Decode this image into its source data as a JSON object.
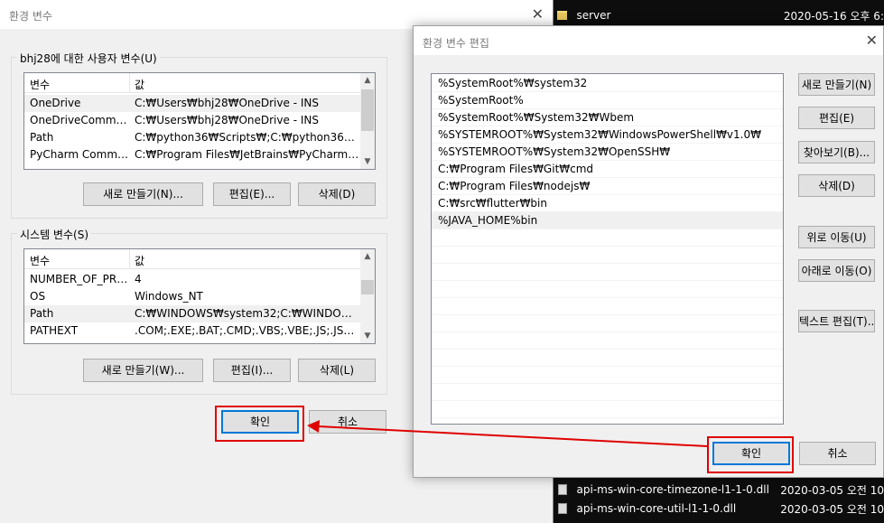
{
  "background": {
    "rows": [
      {
        "name": "server",
        "date": "2020-05-16 오후 6:",
        "type": "folder"
      },
      {
        "name": "api-ms-win-core-timezone-l1-1-0.dll",
        "date": "2020-03-05 오전 10",
        "type": "dll"
      },
      {
        "name": "api-ms-win-core-util-l1-1-0.dll",
        "date": "2020-03-05 오전 10",
        "type": "dll"
      }
    ]
  },
  "main_dialog": {
    "title": "환경 변수",
    "close": "✕",
    "user_group": {
      "legend": "bhj28에 대한 사용자 변수(U)",
      "columns": [
        "변수",
        "값"
      ],
      "rows": [
        {
          "name": "OneDrive",
          "value": "C:₩Users₩bhj28₩OneDrive - INS"
        },
        {
          "name": "OneDriveCommer...",
          "value": "C:₩Users₩bhj28₩OneDrive - INS"
        },
        {
          "name": "Path",
          "value": "C:₩python36₩Scripts₩;C:₩python36₩;C:₩..."
        },
        {
          "name": "PyCharm Commu...",
          "value": "C:₩Program Files₩JetBrains₩PyCharm Co..."
        }
      ],
      "buttons": {
        "new": "새로 만들기(N)...",
        "edit": "편집(E)...",
        "delete": "삭제(D)"
      }
    },
    "system_group": {
      "legend": "시스템 변수(S)",
      "columns": [
        "변수",
        "값"
      ],
      "rows": [
        {
          "name": "NUMBER_OF_PRO...",
          "value": "4"
        },
        {
          "name": "OS",
          "value": "Windows_NT"
        },
        {
          "name": "Path",
          "value": "C:₩WINDOWS₩system32;C:₩WINDOWS;C..."
        },
        {
          "name": "PATHEXT",
          "value": ".COM;.EXE;.BAT;.CMD;.VBS;.VBE;.JS;.JSE;.W..."
        }
      ],
      "buttons": {
        "new": "새로 만들기(W)...",
        "edit": "편집(I)...",
        "delete": "삭제(L)"
      }
    },
    "ok": "확인",
    "cancel": "취소"
  },
  "edit_dialog": {
    "title": "환경 변수 편집",
    "close": "✕",
    "paths": [
      "%SystemRoot%₩system32",
      "%SystemRoot%",
      "%SystemRoot%₩System32₩Wbem",
      "%SYSTEMROOT%₩System32₩WindowsPowerShell₩v1.0₩",
      "%SYSTEMROOT%₩System32₩OpenSSH₩",
      "C:₩Program Files₩Git₩cmd",
      "C:₩Program Files₩nodejs₩",
      "C:₩src₩flutter₩bin",
      "%JAVA_HOME%bin"
    ],
    "selected_index": 8,
    "buttons": {
      "new": "새로 만들기(N)",
      "edit": "편집(E)",
      "browse": "찾아보기(B)...",
      "delete": "삭제(D)",
      "move_up": "위로 이동(U)",
      "move_down": "아래로 이동(O)",
      "edit_text": "텍스트 편집(T)..."
    },
    "ok": "확인",
    "cancel": "취소"
  },
  "colors": {
    "highlight": "#e00000",
    "accent": "#0078d7"
  }
}
